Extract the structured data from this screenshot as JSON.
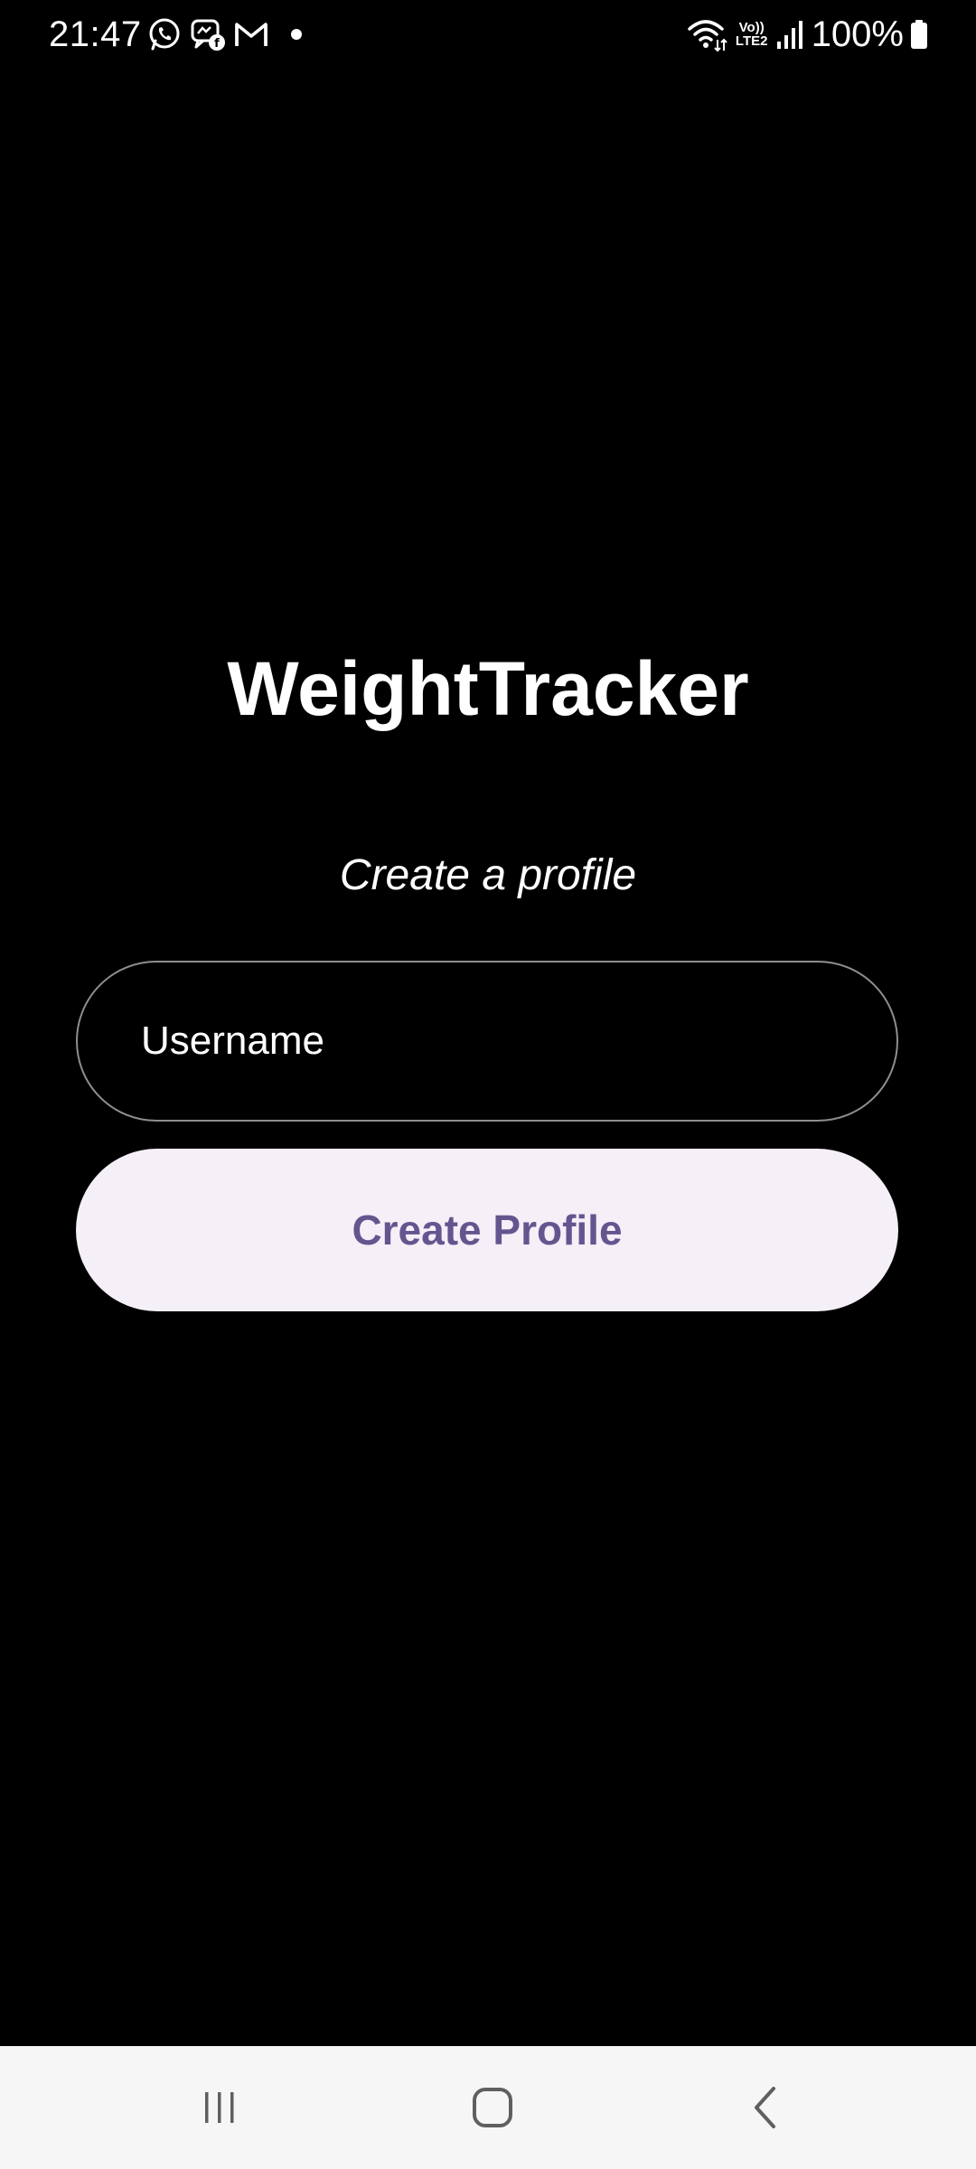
{
  "status_bar": {
    "time": "21:47",
    "notification_icons": [
      "whatsapp-icon",
      "messenger-icon",
      "gmail-icon",
      "more-notifications-dot"
    ],
    "wifi_icon": "wifi-icon",
    "lte_top": "Vo))",
    "lte_bottom": "LTE2",
    "signal_icon": "signal-bars-icon",
    "battery_percent": "100%",
    "battery_icon": "battery-full-icon"
  },
  "main": {
    "title": "WeightTracker",
    "subtitle": "Create a profile",
    "username_field": {
      "placeholder": "Username",
      "value": ""
    },
    "create_button_label": "Create Profile"
  },
  "nav_bar": {
    "recents_icon": "recents-icon",
    "home_icon": "home-icon",
    "back_icon": "back-icon"
  },
  "colors": {
    "background": "#000000",
    "button_background": "#f5eff7",
    "button_text": "#65558f",
    "field_border": "#8e8e8e",
    "nav_background": "#f6f6f6",
    "nav_icon": "#5f5f5f"
  }
}
